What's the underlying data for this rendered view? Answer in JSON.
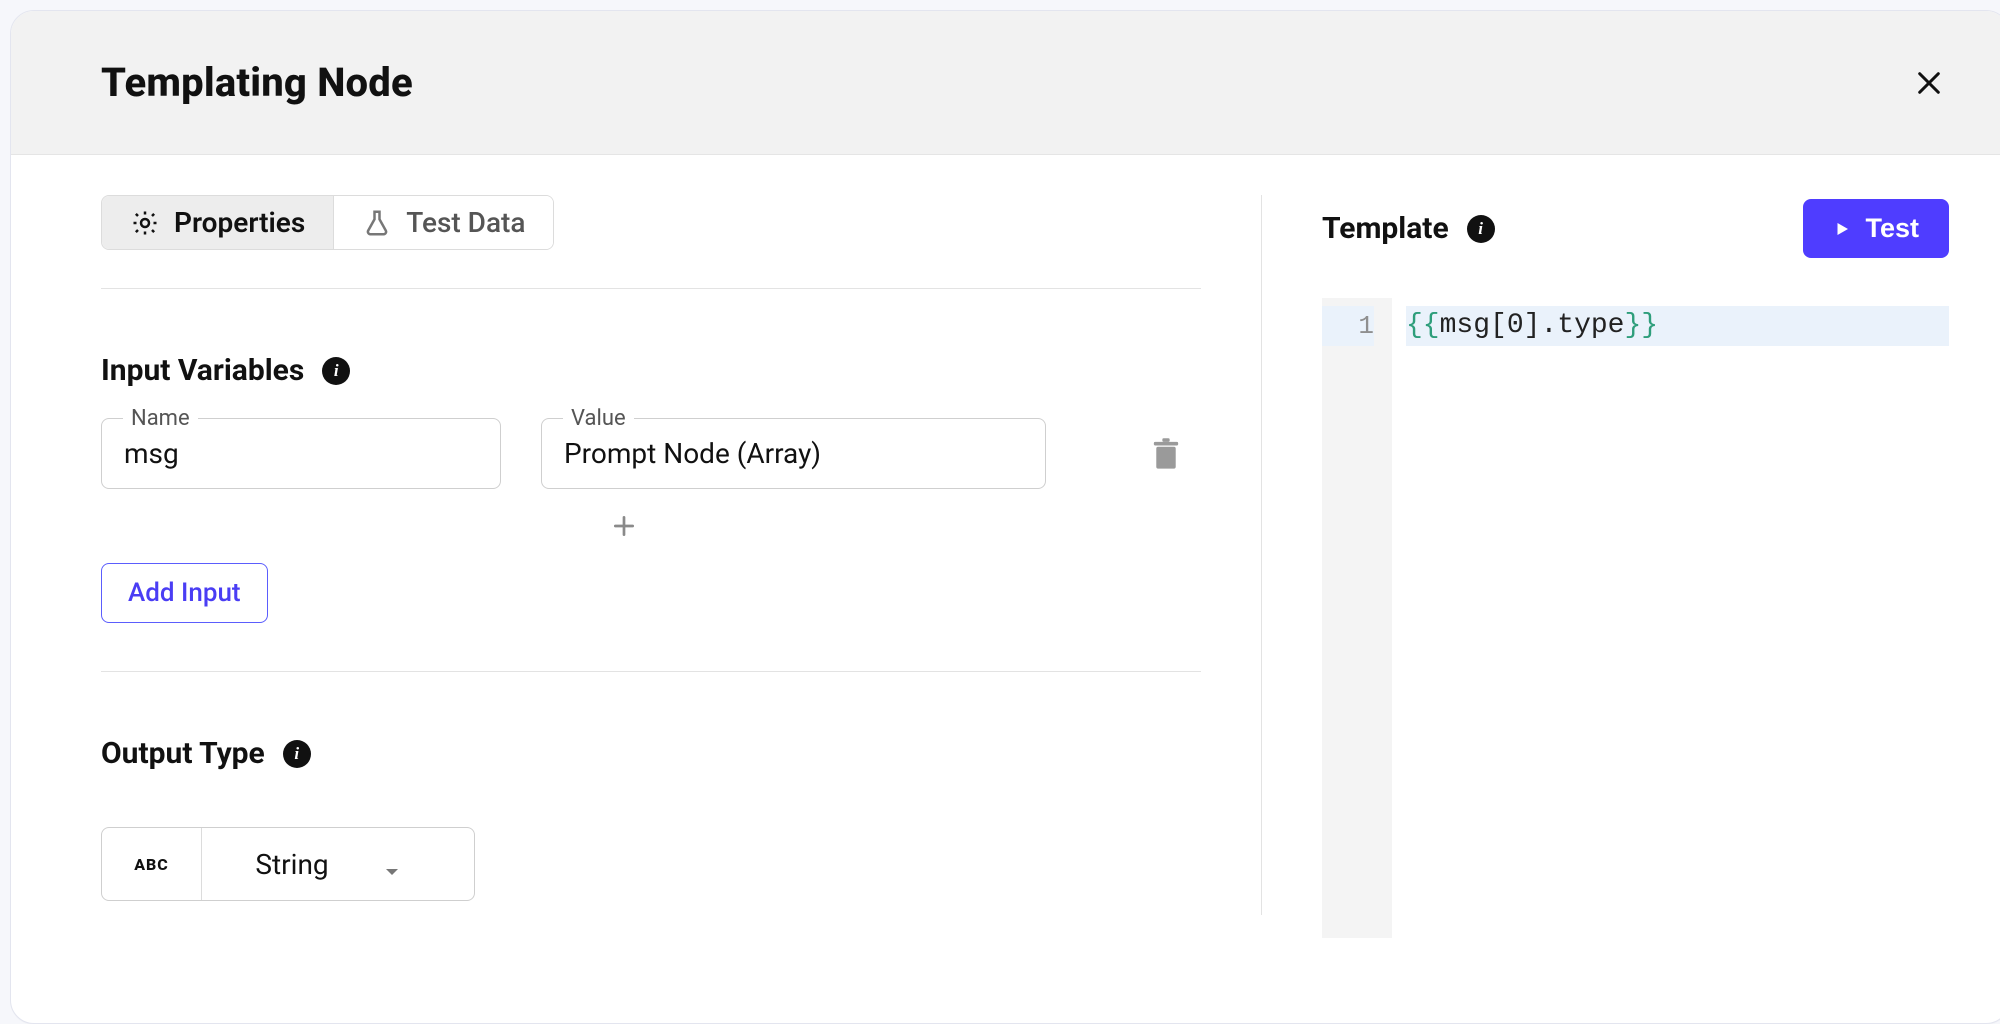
{
  "title": "Templating Node",
  "tabs": {
    "properties": "Properties",
    "test_data": "Test Data"
  },
  "input_variables": {
    "title": "Input Variables",
    "row": {
      "name_label": "Name",
      "name_value": "msg",
      "value_label": "Value",
      "value_value": "Prompt Node (Array)"
    },
    "add_input_label": "Add Input"
  },
  "output_type": {
    "title": "Output Type",
    "icon_text": "ABC",
    "value": "String"
  },
  "template": {
    "title": "Template",
    "test_label": "Test",
    "lines": [
      {
        "num": "1",
        "open": "{{",
        "var": "msg",
        "idx": "[0]",
        "dot": ".",
        "prop": "type",
        "close": "}}"
      }
    ]
  }
}
